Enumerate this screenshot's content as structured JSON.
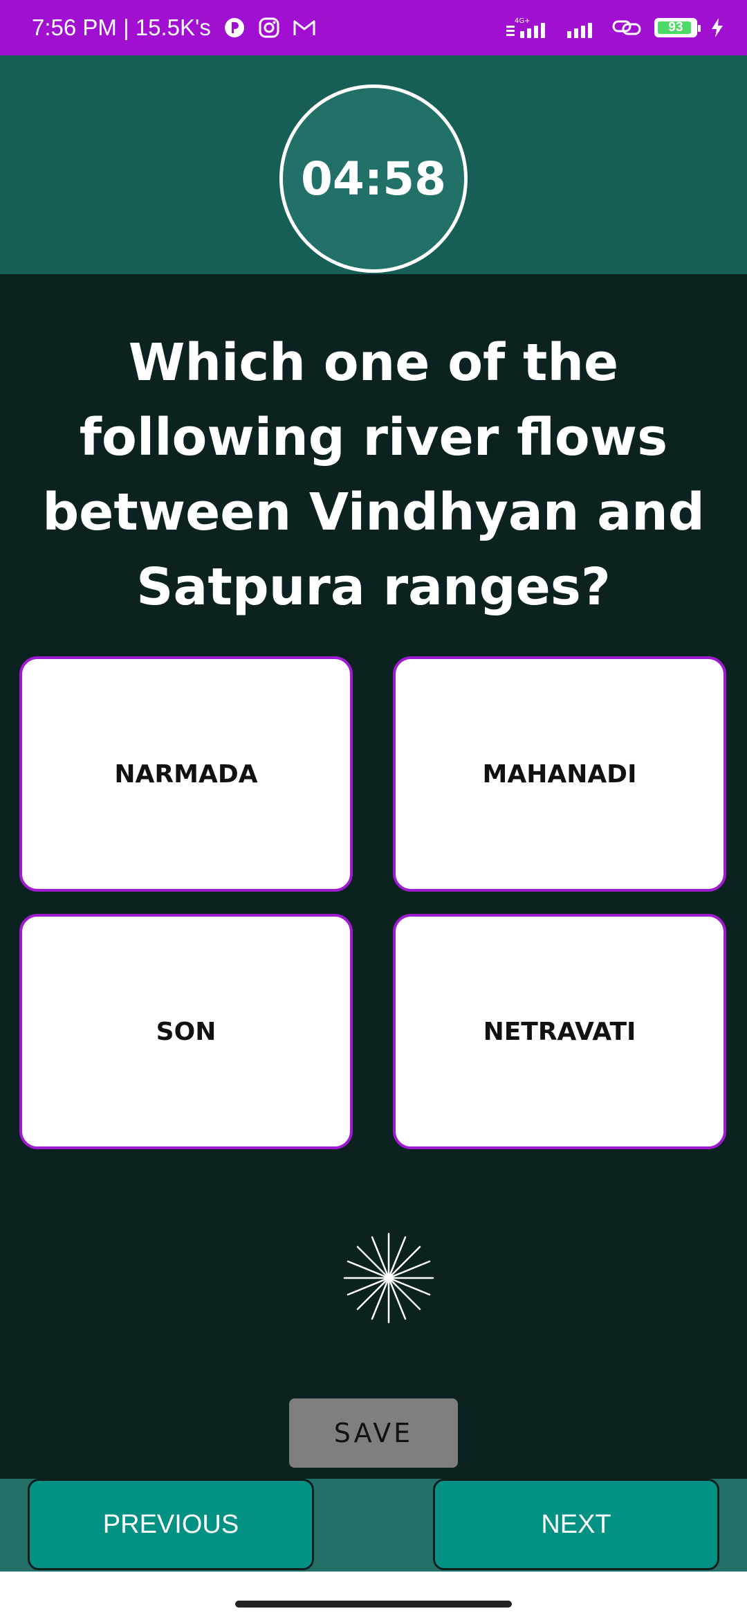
{
  "status_bar": {
    "time_text": "7:56 PM | 15.5K's",
    "network_label": "4G+",
    "battery_level": "93",
    "icons": [
      "notification-app-icon",
      "instagram-icon",
      "gmail-icon",
      "signal-4g-icon",
      "signal-icon",
      "link-icon",
      "battery-icon",
      "charging-icon"
    ]
  },
  "timer": {
    "value": "04:58"
  },
  "question": {
    "text": "Which one of the following river flows between Vindhyan and Satpura ranges?"
  },
  "options": [
    {
      "label": "NARMADA"
    },
    {
      "label": "MAHANADI"
    },
    {
      "label": "SON"
    },
    {
      "label": "NETRAVATI"
    }
  ],
  "actions": {
    "save_label": "SAVE",
    "previous_label": "PREVIOUS",
    "next_label": "NEXT"
  },
  "colors": {
    "status_bar": "#a10fd1",
    "header": "#175e57",
    "background": "#0b2220",
    "option_border": "#9f1bd0",
    "nav_button": "#029183"
  }
}
